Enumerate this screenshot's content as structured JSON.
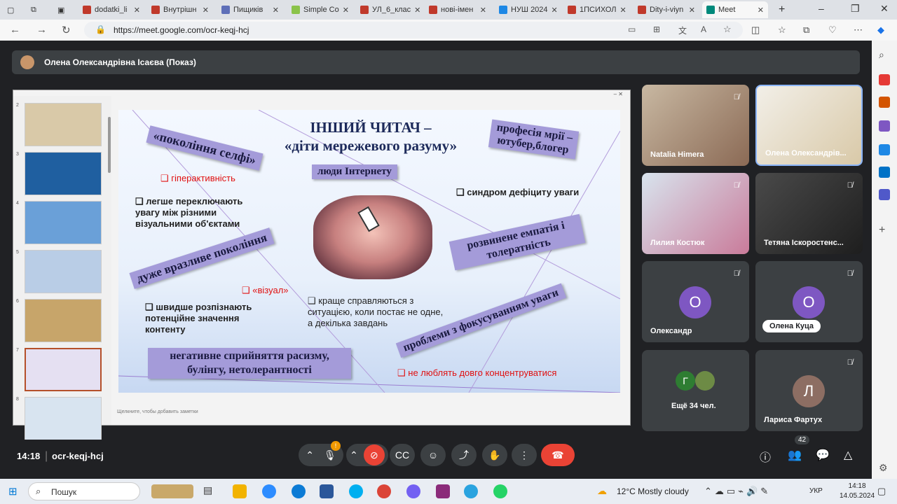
{
  "browser": {
    "tabs": [
      {
        "label": "dodatki_li",
        "color": "#c0392b"
      },
      {
        "label": "Внутрішн",
        "color": "#c0392b"
      },
      {
        "label": "Пищиків",
        "color": "#5e6fb8"
      },
      {
        "label": "Simple Co",
        "color": "#8bc34a"
      },
      {
        "label": "УЛ_6_клас",
        "color": "#c0392b"
      },
      {
        "label": "нові-імен",
        "color": "#c0392b"
      },
      {
        "label": "НУШ 2024",
        "color": "#1e88e5"
      },
      {
        "label": "1ПСИХОЛ",
        "color": "#c0392b"
      },
      {
        "label": "Dity-i-viyn",
        "color": "#c0392b"
      },
      {
        "label": "Meet",
        "color": "#00897b"
      }
    ],
    "url": "https://meet.google.com/ocr-keqj-hcj",
    "new_tab": "+",
    "window_controls": {
      "minimize": "–",
      "maximize": "❐",
      "close": "✕"
    }
  },
  "meet": {
    "presenter_title": "Олена Олександрівна Ісаєва (Показ)",
    "meeting_time": "14:18",
    "meeting_code": "ocr-keqj-hcj",
    "people_count": "42",
    "mic_badge": "!",
    "participants": [
      {
        "name": "Natalia Himera",
        "type": "video"
      },
      {
        "name": "Олена Олександрів...",
        "type": "video"
      },
      {
        "name": "Лилия Костюк",
        "type": "video"
      },
      {
        "name": "Тетяна Іскоростенс...",
        "type": "video"
      },
      {
        "name": "Олександр",
        "type": "avatar",
        "initial": "О",
        "color": "#7e57c2"
      },
      {
        "name": "Олена Куца",
        "type": "avatar",
        "initial": "О",
        "color": "#7e57c2"
      },
      {
        "name": "Ещё 34 чел.",
        "type": "more",
        "initial": "Г"
      },
      {
        "name": "Лариса Фартух",
        "type": "avatar",
        "initial": "Л",
        "color": "#8d6e63"
      }
    ]
  },
  "slide": {
    "title_line1": "ІНШИЙ ЧИТАЧ –",
    "title_line2": "«діти мережевого разуму»",
    "label_selfie": "«покоління  селфі»",
    "label_dream": "професія мрії –",
    "label_dream2": "ютубер,блогер",
    "label_internet": "люди Інтернету",
    "hyper": "гіперактивність",
    "switch": "легше переключають увагу між різними візуальними об'єктами",
    "deficit": "синдром дефіциту уваги",
    "vulnerable": "дуже вразливе покоління",
    "empathy": "розвинене емпатія і толератність",
    "visual": "«візуал»",
    "recognize": "швидше розпізнають потенційне значення контенту",
    "cope": "краще справляються з ситуацією, коли постає не одне, а декілька завдань",
    "focus": "проблеми з фокусуванням уваги",
    "racism": "негативне сприйняття расизму, булінгу, нетолерантності",
    "concentrate": "не люблять довго концентруватися",
    "notes": "Щелкните, чтобы добавить заметки"
  },
  "thumbnails": [
    "2",
    "3",
    "4",
    "5",
    "6",
    "7",
    "8"
  ],
  "taskbar": {
    "search": "Пошук",
    "weather": "12°C  Mostly cloudy",
    "lang": "УКР",
    "time": "14:18",
    "date": "14.05.2024"
  },
  "icons": [
    "back-icon",
    "forward-icon",
    "refresh-icon",
    "lock-icon",
    "mic-icon",
    "camera-off-icon",
    "captions-icon",
    "emoji-icon",
    "present-icon",
    "hand-icon",
    "more-icon",
    "end-call-icon",
    "info-icon",
    "people-icon",
    "chat-icon",
    "activities-icon"
  ]
}
